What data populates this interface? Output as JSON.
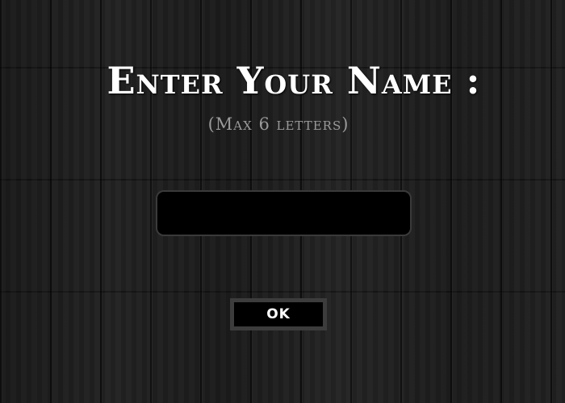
{
  "dialog": {
    "title": "Enter Your Name :",
    "subtitle": "(Max 6 letters)",
    "name_input": {
      "value": "",
      "placeholder": ""
    },
    "ok_label": "OK"
  },
  "colors": {
    "title_text": "#ffffff",
    "subtitle_text": "#9a9a9a",
    "input_background": "#000000",
    "input_border": "#3a3a3a",
    "button_background": "#000000",
    "button_border": "#3c3c3c",
    "background": "#1c1c1c"
  }
}
